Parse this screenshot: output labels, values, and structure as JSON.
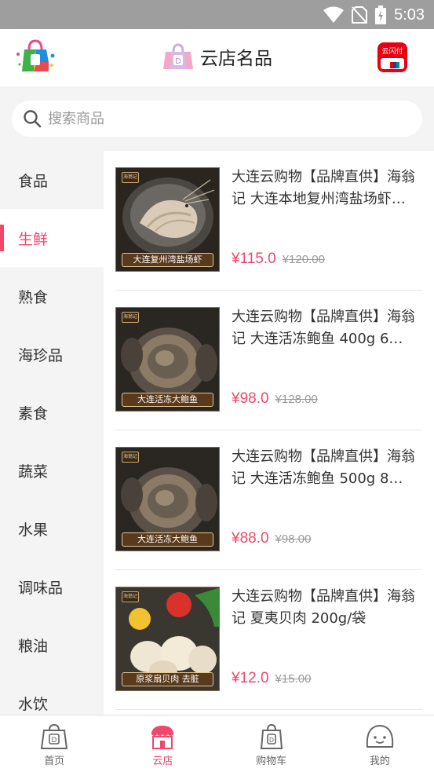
{
  "status_bar": {
    "time": "5:03"
  },
  "header": {
    "title": "云店名品",
    "pay_badge_text": "云闪付"
  },
  "search": {
    "placeholder": "搜索商品"
  },
  "categories": [
    {
      "label": "食品",
      "active": false
    },
    {
      "label": "生鲜",
      "active": true
    },
    {
      "label": "熟食",
      "active": false
    },
    {
      "label": "海珍品",
      "active": false
    },
    {
      "label": "素食",
      "active": false
    },
    {
      "label": "蔬菜",
      "active": false
    },
    {
      "label": "水果",
      "active": false
    },
    {
      "label": "调味品",
      "active": false
    },
    {
      "label": "粮油",
      "active": false
    },
    {
      "label": "水饮",
      "active": false
    }
  ],
  "products": [
    {
      "title": "大连云购物【品牌直供】海翁记 大连本地复州湾盐场虾…",
      "price": "¥115.0",
      "old_price": "¥120.00",
      "image_caption": "大连复州湾盐场虾",
      "image_icon": "shrimp-product-image"
    },
    {
      "title": "大连云购物【品牌直供】海翁记 大连活冻鲍鱼 400g 6…",
      "price": "¥98.0",
      "old_price": "¥128.00",
      "image_caption": "大连活冻大鲍鱼",
      "image_icon": "abalone-product-image"
    },
    {
      "title": "大连云购物【品牌直供】海翁记 大连活冻鲍鱼 500g 8…",
      "price": "¥88.0",
      "old_price": "¥98.00",
      "image_caption": "大连活冻大鲍鱼",
      "image_icon": "abalone-product-image"
    },
    {
      "title": "大连云购物【品牌直供】海翁记 夏夷贝肉 200g/袋",
      "price": "¥12.0",
      "old_price": "¥15.00",
      "image_caption": "原浆扇贝肉 去脏",
      "image_icon": "scallop-product-image"
    }
  ],
  "bottom_nav": [
    {
      "label": "首页",
      "icon": "home-bag-icon",
      "active": false
    },
    {
      "label": "云店",
      "icon": "store-icon",
      "active": true
    },
    {
      "label": "购物车",
      "icon": "cart-bag-icon",
      "active": false
    },
    {
      "label": "我的",
      "icon": "profile-icon",
      "active": false
    }
  ],
  "colors": {
    "accent": "#f0476b",
    "status_bar": "#9e9e9e",
    "background": "#f4f4f4"
  }
}
